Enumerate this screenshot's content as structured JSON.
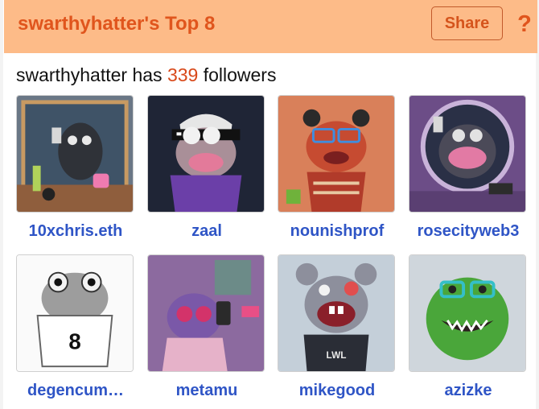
{
  "header": {
    "title": "swarthyhatter's Top 8",
    "share_label": "Share",
    "help_label": "?",
    "background_color": "#fdbb88",
    "accent_color": "#e0551d"
  },
  "followers": {
    "username": "swarthyhatter",
    "middle": "has",
    "count": "339",
    "suffix": "followers"
  },
  "friends": [
    {
      "name": "10xchris.eth",
      "avatar": "frog-with-phone-in-mirror"
    },
    {
      "name": "zaal",
      "avatar": "creature-with-pixel-sunglasses"
    },
    {
      "name": "nounishprof",
      "avatar": "creature-with-blue-glasses"
    },
    {
      "name": "rosecityweb3",
      "avatar": "purple-monster-in-mirror"
    },
    {
      "name": "degencum…",
      "avatar": "frog-with-number-8"
    },
    {
      "name": "metamu",
      "avatar": "creature-with-pink-glasses"
    },
    {
      "name": "mikegood",
      "avatar": "mouse-with-lwl-shirt"
    },
    {
      "name": "azizke",
      "avatar": "green-monster-with-glasses"
    }
  ]
}
